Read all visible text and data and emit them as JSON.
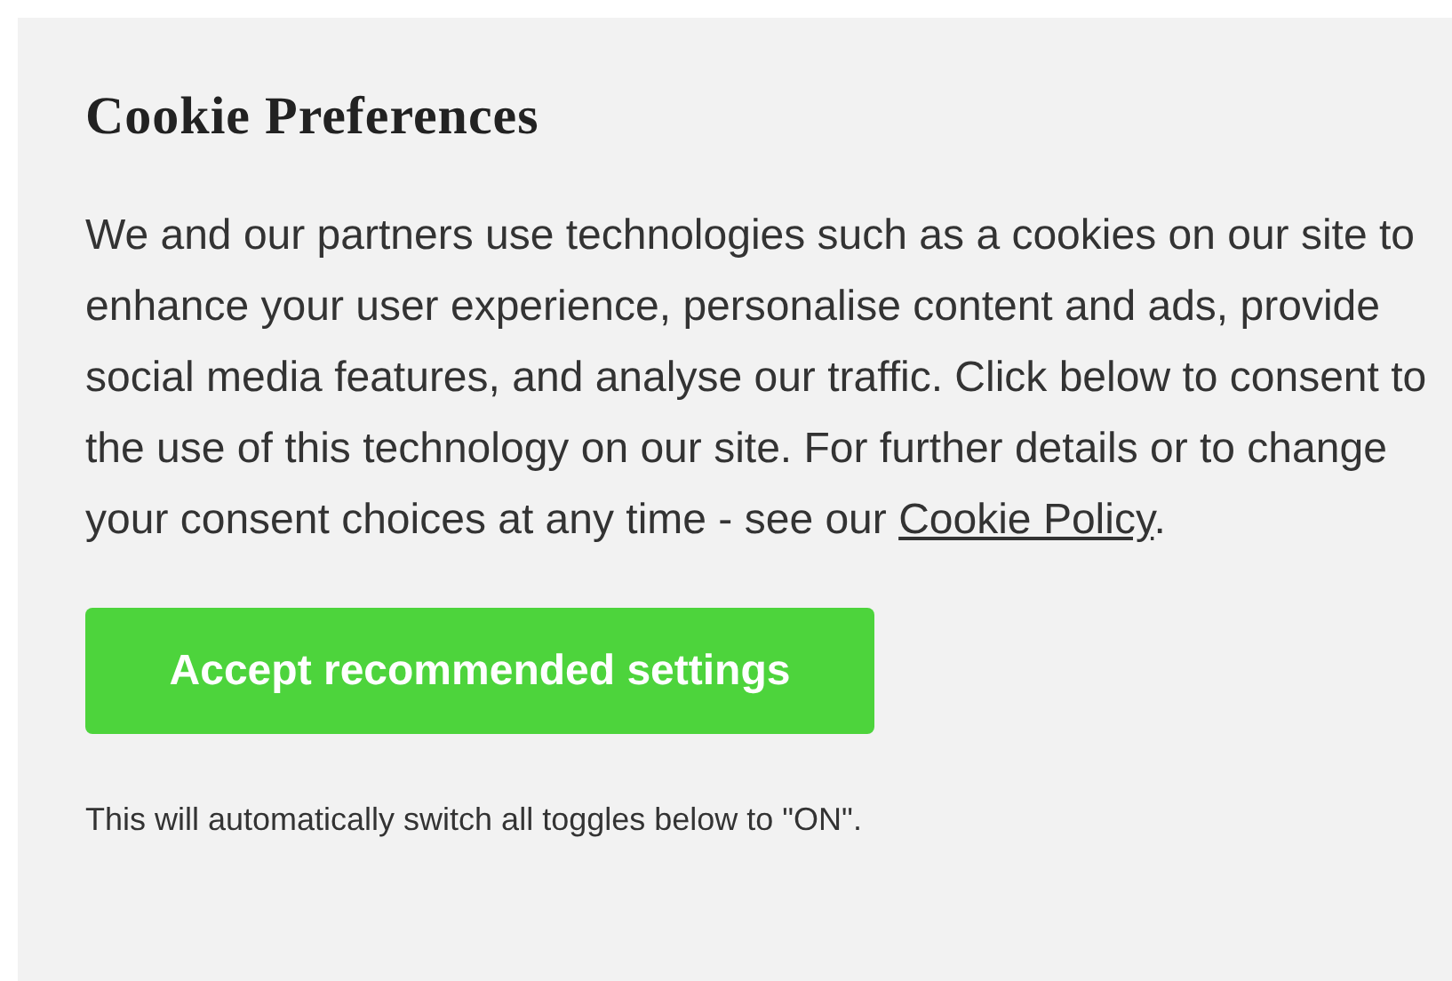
{
  "title": "Cookie Preferences",
  "paragraph": {
    "text": "We and our partners use technologies such as a cookies on our site to enhance your user experience, personalise content and ads, provide social media features, and analyse our traffic. Click below to consent to the use of this technology on our site. For further details or to change your consent choices at any time - see our ",
    "link": "Cookie Policy",
    "end": "."
  },
  "button": "Accept recommended settings",
  "note": "This will automatically switch all toggles below to \"ON\"."
}
